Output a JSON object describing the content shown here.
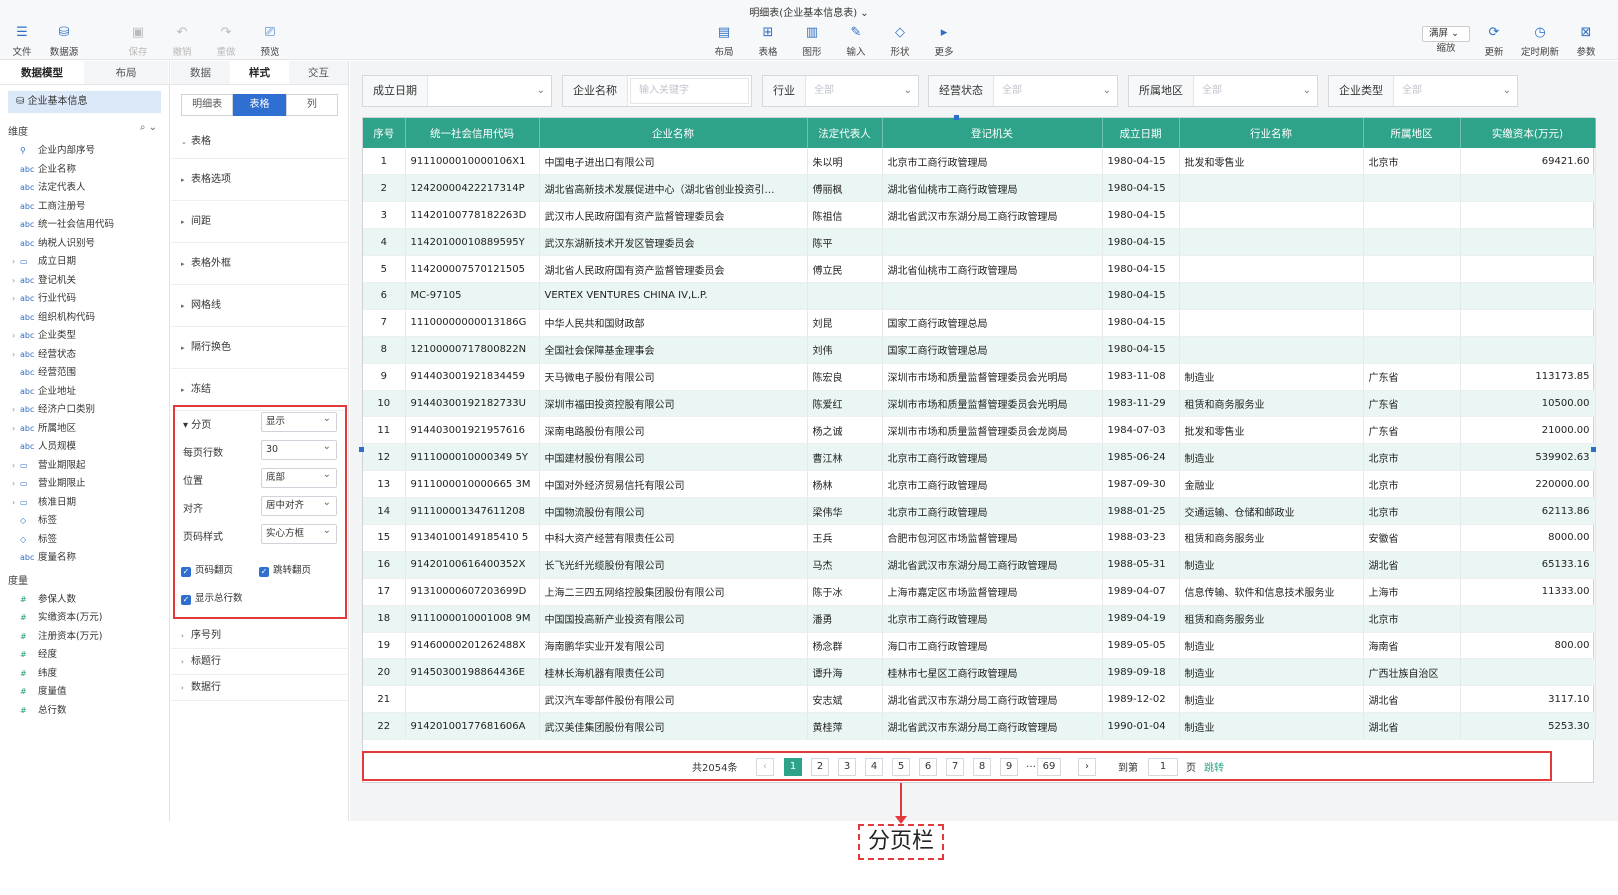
{
  "window": {
    "title": "明细表(企业基本信息表)"
  },
  "toolbar": {
    "file": "文件",
    "datasource": "数据源",
    "save": "保存",
    "undo": "撤销",
    "redo": "重做",
    "preview": "预览",
    "layout": "布局",
    "table": "表格",
    "chart": "图形",
    "input": "输入",
    "shape": "形状",
    "more": "更多",
    "screen_mode": "满屏",
    "zoom": "缩放",
    "update": "更新",
    "scheduled_refresh": "定时刷新",
    "params": "参数"
  },
  "left_panel": {
    "tabs": [
      "数据模型",
      "布局"
    ],
    "datasource": "企业基本信息",
    "dim_header": "维度",
    "measure_header": "度量",
    "dimensions": [
      {
        "name": "企业内部序号",
        "type": "key",
        "exp": false
      },
      {
        "name": "企业名称",
        "type": "abc",
        "exp": false
      },
      {
        "name": "法定代表人",
        "type": "abc",
        "exp": false
      },
      {
        "name": "工商注册号",
        "type": "abc",
        "exp": false
      },
      {
        "name": "统一社会信用代码",
        "type": "abc",
        "exp": false
      },
      {
        "name": "纳税人识别号",
        "type": "abc",
        "exp": false
      },
      {
        "name": "成立日期",
        "type": "date",
        "exp": true
      },
      {
        "name": "登记机关",
        "type": "abc",
        "exp": true
      },
      {
        "name": "行业代码",
        "type": "abc",
        "exp": true
      },
      {
        "name": "组织机构代码",
        "type": "abc",
        "exp": false
      },
      {
        "name": "企业类型",
        "type": "abc",
        "exp": true
      },
      {
        "name": "经营状态",
        "type": "abc",
        "exp": true
      },
      {
        "name": "经营范围",
        "type": "abc",
        "exp": false
      },
      {
        "name": "企业地址",
        "type": "abc",
        "exp": false
      },
      {
        "name": "经济户口类别",
        "type": "abc",
        "exp": true
      },
      {
        "name": "所属地区",
        "type": "abc",
        "exp": true
      },
      {
        "name": "人员规模",
        "type": "abc",
        "exp": false
      },
      {
        "name": "营业期限起",
        "type": "date",
        "exp": true
      },
      {
        "name": "营业期限止",
        "type": "date",
        "exp": true
      },
      {
        "name": "核准日期",
        "type": "date",
        "exp": true
      },
      {
        "name": "标签",
        "type": "tag",
        "exp": false
      },
      {
        "name": "标签",
        "type": "tag",
        "exp": false
      },
      {
        "name": "度量名称",
        "type": "abc",
        "exp": false
      }
    ],
    "measures": [
      "参保人数",
      "实缴资本(万元)",
      "注册资本(万元)",
      "经度",
      "纬度",
      "度量值",
      "总行数"
    ]
  },
  "style_panel": {
    "tabs": [
      "数据",
      "样式",
      "交互"
    ],
    "segments": [
      "明细表",
      "表格",
      "列"
    ],
    "sections": [
      "表格",
      "表格选项",
      "间距",
      "表格外框",
      "网格线",
      "隔行换色",
      "冻结"
    ],
    "pagination": {
      "title": "分页",
      "show": "显示",
      "rows_label": "每页行数",
      "rows": "30",
      "pos_label": "位置",
      "pos": "底部",
      "align_label": "对齐",
      "align": "居中对齐",
      "style_label": "页码样式",
      "style": "实心方框",
      "chk_pageflip": "页码翻页",
      "chk_jump": "跳转翻页",
      "chk_total": "显示总行数"
    },
    "after": [
      "序号列",
      "标题行",
      "数据行"
    ]
  },
  "filters": [
    {
      "label": "成立日期",
      "value": "",
      "kind": "select"
    },
    {
      "label": "企业名称",
      "value": "输入关键字",
      "kind": "input"
    },
    {
      "label": "行业",
      "value": "全部",
      "kind": "select"
    },
    {
      "label": "经营状态",
      "value": "全部",
      "kind": "select"
    },
    {
      "label": "所属地区",
      "value": "全部",
      "kind": "select"
    },
    {
      "label": "企业类型",
      "value": "全部",
      "kind": "select"
    }
  ],
  "table": {
    "columns": [
      "序号",
      "统一社会信用代码",
      "企业名称",
      "法定代表人",
      "登记机关",
      "成立日期",
      "行业名称",
      "所属地区",
      "实缴资本(万元)"
    ],
    "rows": [
      [
        "1",
        "9111000010000106X1",
        "中国电子进出口有限公司",
        "朱以明",
        "北京市工商行政管理局",
        "1980-04-15",
        "批发和零售业",
        "北京市",
        "69421.60"
      ],
      [
        "2",
        "12420000422217314P",
        "湖北省高新技术发展促进中心（湖北省创业投资引…",
        "傅丽枫",
        "湖北省仙桃市工商行政管理局",
        "1980-04-15",
        "",
        "",
        ""
      ],
      [
        "3",
        "11420100778182263D",
        "武汉市人民政府国有资产监督管理委员会",
        "陈祖信",
        "湖北省武汉市东湖分局工商行政管理局",
        "1980-04-15",
        "",
        "",
        ""
      ],
      [
        "4",
        "11420100010889595Y",
        "武汉东湖新技术开发区管理委员会",
        "陈平",
        "",
        "1980-04-15",
        "",
        "",
        ""
      ],
      [
        "5",
        "114200007570121505",
        "湖北省人民政府国有资产监督管理委员会",
        "傅立民",
        "湖北省仙桃市工商行政管理局",
        "1980-04-15",
        "",
        "",
        ""
      ],
      [
        "6",
        "MC-97105",
        "VERTEX VENTURES CHINA IV,L.P.",
        "",
        "",
        "1980-04-15",
        "",
        "",
        ""
      ],
      [
        "7",
        "11100000000013186G",
        "中华人民共和国财政部",
        "刘昆",
        "国家工商行政管理总局",
        "1980-04-15",
        "",
        "",
        ""
      ],
      [
        "8",
        "12100000717800822N",
        "全国社会保障基金理事会",
        "刘伟",
        "国家工商行政管理总局",
        "1980-04-15",
        "",
        "",
        ""
      ],
      [
        "9",
        "914403001921834459",
        "天马微电子股份有限公司",
        "陈宏良",
        "深圳市市场和质量监督管理委员会光明局",
        "1983-11-08",
        "制造业",
        "广东省",
        "113173.85"
      ],
      [
        "10",
        "91440300192182733U",
        "深圳市福田投资控股有限公司",
        "陈爱红",
        "深圳市市场和质量监督管理委员会光明局",
        "1983-11-29",
        "租赁和商务服务业",
        "广东省",
        "10500.00"
      ],
      [
        "11",
        "914403001921957616",
        "深南电路股份有限公司",
        "杨之诚",
        "深圳市市场和质量监督管理委员会龙岗局",
        "1984-07-03",
        "批发和零售业",
        "广东省",
        "21000.00"
      ],
      [
        "12",
        "9111000010000349 5Y",
        "中国建材股份有限公司",
        "曹江林",
        "北京市工商行政管理局",
        "1985-06-24",
        "制造业",
        "北京市",
        "539902.63"
      ],
      [
        "13",
        "9111000010000665 3M",
        "中国对外经济贸易信托有限公司",
        "杨林",
        "北京市工商行政管理局",
        "1987-09-30",
        "金融业",
        "北京市",
        "220000.00"
      ],
      [
        "14",
        "911100001347611208",
        "中国物流股份有限公司",
        "梁伟华",
        "北京市工商行政管理局",
        "1988-01-25",
        "交通运输、仓储和邮政业",
        "北京市",
        "62113.86"
      ],
      [
        "15",
        "91340100149185410 5",
        "中科大资产经营有限责任公司",
        "王兵",
        "合肥市包河区市场监督管理局",
        "1988-03-23",
        "租赁和商务服务业",
        "安徽省",
        "8000.00"
      ],
      [
        "16",
        "91420100616400352X",
        "长飞光纤光缆股份有限公司",
        "马杰",
        "湖北省武汉市东湖分局工商行政管理局",
        "1988-05-31",
        "制造业",
        "湖北省",
        "65133.16"
      ],
      [
        "17",
        "91310000607203699D",
        "上海二三四五网络控股集团股份有限公司",
        "陈于冰",
        "上海市嘉定区市场监督管理局",
        "1989-04-07",
        "信息传输、软件和信息技术服务业",
        "上海市",
        "11333.00"
      ],
      [
        "18",
        "9111000010001008 9M",
        "中国国投高新产业投资有限公司",
        "潘勇",
        "北京市工商行政管理局",
        "1989-04-19",
        "租赁和商务服务业",
        "北京市",
        ""
      ],
      [
        "19",
        "91460000201262488X",
        "海南鹏华实业开发有限公司",
        "杨念群",
        "海口市工商行政管理局",
        "1989-05-05",
        "制造业",
        "海南省",
        "800.00"
      ],
      [
        "20",
        "91450300198864436E",
        "桂林长海机器有限责任公司",
        "谭升海",
        "桂林市七星区工商行政管理局",
        "1989-09-18",
        "制造业",
        "广西壮族自治区",
        ""
      ],
      [
        "21",
        "",
        "武汉汽车零部件股份有限公司",
        "安志斌",
        "湖北省武汉市东湖分局工商行政管理局",
        "1989-12-02",
        "制造业",
        "湖北省",
        "3117.10"
      ],
      [
        "22",
        "91420100177681606A",
        "武汉美佳集团股份有限公司",
        "黄桂萍",
        "湖北省武汉市东湖分局工商行政管理局",
        "1990-01-04",
        "制造业",
        "湖北省",
        "5253.30"
      ]
    ]
  },
  "pager": {
    "total": "共2054条",
    "pages": [
      "1",
      "2",
      "3",
      "4",
      "5",
      "6",
      "7",
      "8",
      "9",
      "…",
      "69"
    ],
    "current": "1",
    "goto_label": "到第",
    "goto_value": "1",
    "page_unit": "页",
    "jump": "跳转"
  },
  "callout": {
    "label": "分页栏"
  },
  "colors": {
    "header": "#2fa389",
    "alt_row": "#eaf6f3",
    "highlight": "#e23a3a",
    "accent": "#2f6fd1"
  }
}
